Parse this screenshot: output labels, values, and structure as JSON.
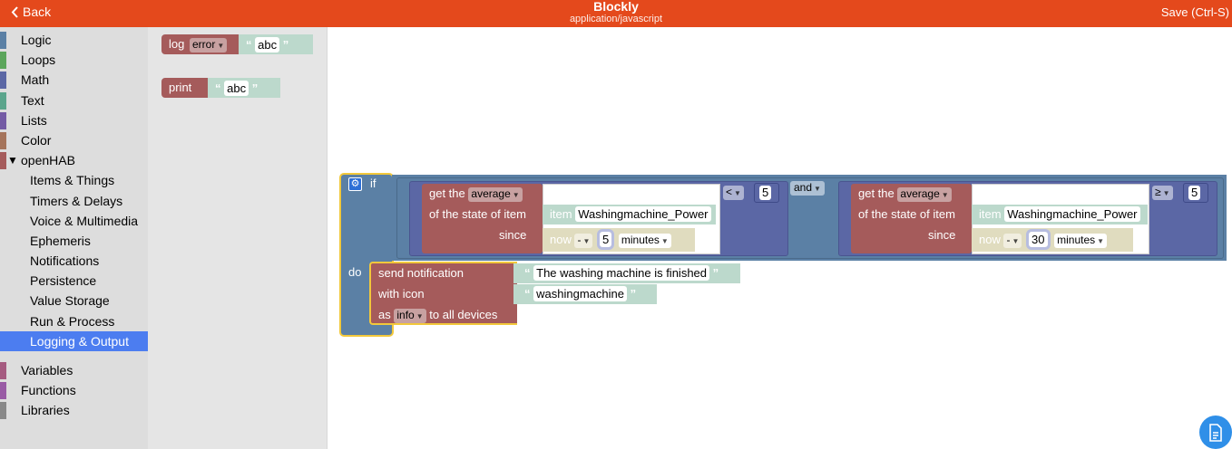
{
  "header": {
    "back_label": "Back",
    "title": "Blockly",
    "subtitle": "application/javascript",
    "save_label": "Save (Ctrl-S)"
  },
  "toolbox": {
    "categories": [
      {
        "label": "Logic",
        "color": "#5b80a5"
      },
      {
        "label": "Loops",
        "color": "#5ba55b"
      },
      {
        "label": "Math",
        "color": "#5b67a5"
      },
      {
        "label": "Text",
        "color": "#5ba58c"
      },
      {
        "label": "Lists",
        "color": "#745ba5"
      },
      {
        "label": "Color",
        "color": "#a5745b"
      },
      {
        "label": "openHAB",
        "color": "#a55b5b"
      }
    ],
    "openhab_items": [
      "Items & Things",
      "Timers & Delays",
      "Voice & Multimedia",
      "Ephemeris",
      "Notifications",
      "Persistence",
      "Value Storage",
      "Run & Process",
      "Logging & Output"
    ],
    "selected": "Logging & Output",
    "bottom_categories": [
      {
        "label": "Variables",
        "color": "#a55b80"
      },
      {
        "label": "Functions",
        "color": "#995ba5"
      },
      {
        "label": "Libraries",
        "color": "#888888"
      }
    ]
  },
  "flyout": {
    "log_block": {
      "keyword": "log",
      "level": "error",
      "text": "abc"
    },
    "print_block": {
      "keyword": "print",
      "text": "abc"
    }
  },
  "workspace": {
    "if_block": {
      "if_label": "if",
      "do_label": "do",
      "condition_left": {
        "get_the": "get the",
        "func": "average",
        "of_state": "of the state of item",
        "item_kw": "item",
        "item_name": "Washingmachine_Power",
        "since": "since",
        "now": "now",
        "op": "-",
        "amount": "5",
        "unit": "minutes",
        "compare": "<",
        "value": "5"
      },
      "logic_op": "and",
      "condition_right": {
        "get_the": "get the",
        "func": "average",
        "of_state": "of the state of item",
        "item_kw": "item",
        "item_name": "Washingmachine_Power",
        "since": "since",
        "now": "now",
        "op": "-",
        "amount": "30",
        "unit": "minutes",
        "compare": "≥",
        "value": "5"
      },
      "notification": {
        "send": "send notification",
        "message": "The washing machine is finished",
        "with_icon": "with icon",
        "icon": "washingmachine",
        "as": "as",
        "level": "info",
        "to_all": "to all devices"
      }
    }
  },
  "fab": {
    "icon": "document-icon"
  }
}
